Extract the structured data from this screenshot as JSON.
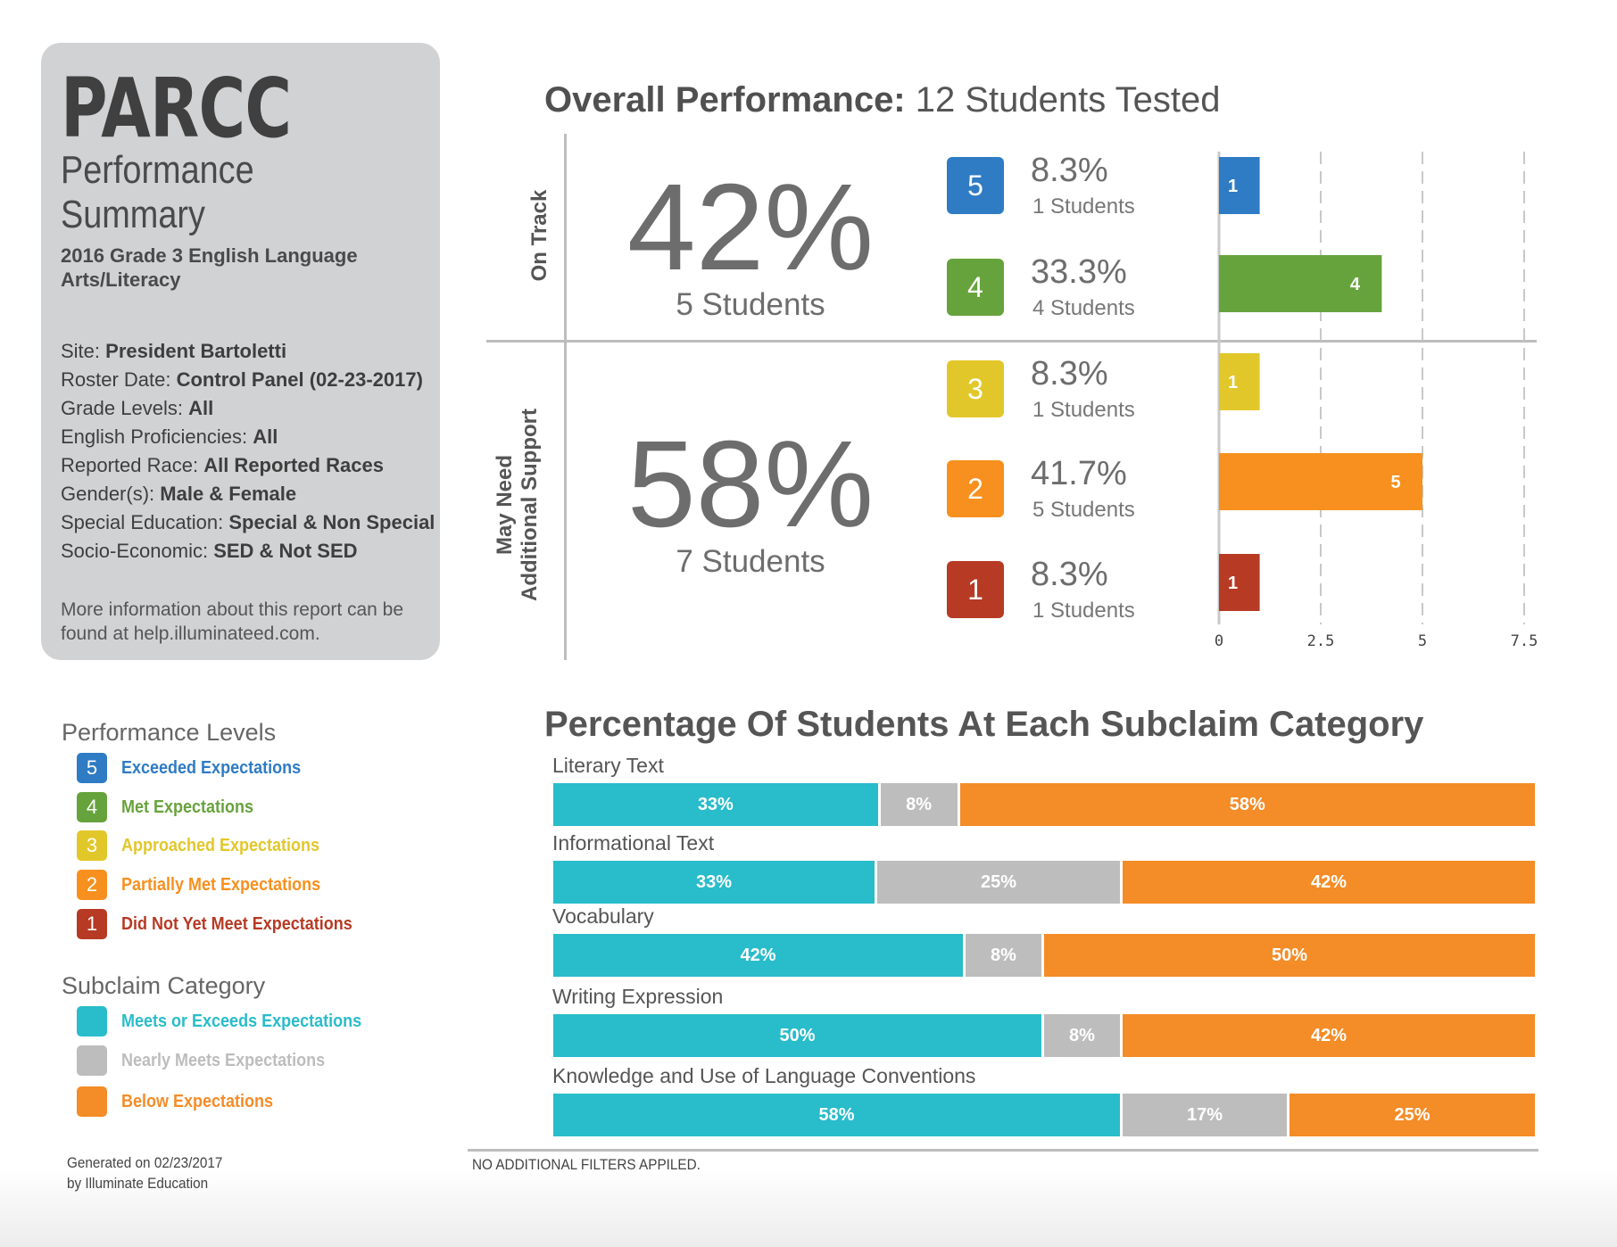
{
  "summary": {
    "title": "PARCC",
    "subtitle_line1": "Performance",
    "subtitle_line2": "Summary",
    "test": "2016 Grade 3 English Language Arts/Literacy",
    "meta": [
      {
        "label": "Site: ",
        "value": "President Bartoletti"
      },
      {
        "label": "Roster Date: ",
        "value": "Control Panel (02-23-2017)"
      },
      {
        "label": "Grade Levels: ",
        "value": "All"
      },
      {
        "label": "English Proficiencies: ",
        "value": "All"
      },
      {
        "label": "Reported Race: ",
        "value": "All Reported Races"
      },
      {
        "label": "Gender(s): ",
        "value": "Male & Female"
      },
      {
        "label": "Special Education: ",
        "value": "Special & Non Special"
      },
      {
        "label": "Socio-Economic: ",
        "value": "SED & Not SED"
      }
    ],
    "info_line1": "More information about this report can be",
    "info_line2": "found at help.illuminateed.com."
  },
  "performance_legend": {
    "title": "Performance Levels",
    "items": [
      {
        "num": "5",
        "label": "Exceeded Expectations",
        "color": "#2f7bc4"
      },
      {
        "num": "4",
        "label": "Met Expectations",
        "color": "#67a33c"
      },
      {
        "num": "3",
        "label": "Approached Expectations",
        "color": "#e2c72a"
      },
      {
        "num": "2",
        "label": "Partially Met Expectations",
        "color": "#f7901e"
      },
      {
        "num": "1",
        "label": "Did Not Yet Meet Expectations",
        "color": "#b63a24"
      }
    ]
  },
  "subclaim_legend": {
    "title": "Subclaim Category",
    "items": [
      {
        "label": "Meets or Exceeds Expectations",
        "color": "#29bccb"
      },
      {
        "label": "Nearly Meets Expectations",
        "color": "#bdbdbd"
      },
      {
        "label": "Below Expectations",
        "color": "#f48c27"
      }
    ]
  },
  "footer": {
    "generated_line1": "Generated on 02/23/2017",
    "generated_line2": "by Illuminate Education",
    "filters": "NO ADDITIONAL FILTERS APPILED."
  },
  "overall": {
    "heading_bold": "Overall Performance:",
    "heading_rest": " 12 Students Tested",
    "on_track_label": "On Track",
    "support_label_line1": "May Need",
    "support_label_line2": "Additional Support",
    "on_track_pct": "42%",
    "on_track_students": "5 Students",
    "support_pct": "58%",
    "support_students": "7 Students"
  },
  "chart_data": [
    {
      "type": "bar",
      "orientation": "horizontal",
      "categories": [
        "5",
        "4",
        "3",
        "2",
        "1"
      ],
      "values": [
        1,
        4,
        1,
        5,
        1
      ],
      "percent_labels": [
        "8.3%",
        "33.3%",
        "8.3%",
        "41.7%",
        "8.3%"
      ],
      "count_labels": [
        "1 Students",
        "4 Students",
        "1 Students",
        "5 Students",
        "1 Students"
      ],
      "colors": [
        "#2f7bc4",
        "#67a33c",
        "#e2c72a",
        "#f7901e",
        "#b63a24"
      ],
      "xlim": [
        0,
        7.5
      ],
      "xticks": [
        "0",
        "2.5",
        "5",
        "7.5"
      ],
      "grid": true
    },
    {
      "type": "bar",
      "orientation": "horizontal",
      "stacked": true,
      "title": "Percentage Of Students At Each Subclaim Category",
      "categories": [
        "Literary Text",
        "Informational Text",
        "Vocabulary",
        "Writing Expression",
        "Knowledge and Use of Language Conventions"
      ],
      "series": [
        {
          "name": "Meets or Exceeds Expectations",
          "color": "#29bccb",
          "values": [
            33,
            33,
            42,
            50,
            58
          ],
          "labels": [
            "33%",
            "33%",
            "42%",
            "50%",
            "58%"
          ]
        },
        {
          "name": "Nearly Meets Expectations",
          "color": "#bdbdbd",
          "values": [
            8,
            25,
            8,
            8,
            17
          ],
          "labels": [
            "8%",
            "25%",
            "8%",
            "8%",
            "17%"
          ]
        },
        {
          "name": "Below Expectations",
          "color": "#f48c27",
          "values": [
            58,
            42,
            50,
            42,
            25
          ],
          "labels": [
            "58%",
            "42%",
            "50%",
            "42%",
            "25%"
          ]
        }
      ]
    }
  ]
}
